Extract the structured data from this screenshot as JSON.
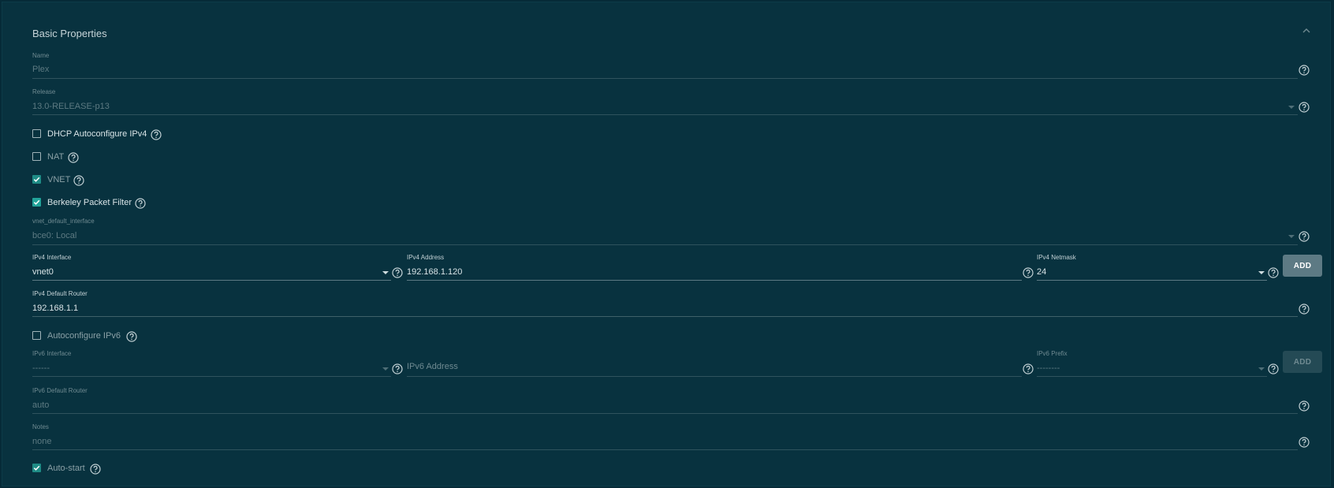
{
  "section": {
    "title": "Basic Properties"
  },
  "name": {
    "label": "Name",
    "value": "Plex"
  },
  "release": {
    "label": "Release",
    "value": "13.0-RELEASE-p13"
  },
  "dhcp": {
    "label": "DHCP Autoconfigure IPv4",
    "checked": false
  },
  "nat": {
    "label": "NAT",
    "checked": false
  },
  "vnet": {
    "label": "VNET",
    "checked": true
  },
  "bpf": {
    "label": "Berkeley Packet Filter",
    "checked": true
  },
  "vnet_default_interface": {
    "label": "vnet_default_interface",
    "value": "bce0: Local"
  },
  "ipv4": {
    "interface_label": "IPv4 Interface",
    "interface_value": "vnet0",
    "address_label": "IPv4 Address",
    "address_value": "192.168.1.120",
    "netmask_label": "IPv4 Netmask",
    "netmask_value": "24",
    "add_label": "ADD",
    "router_label": "IPv4 Default Router",
    "router_value": "192.168.1.1"
  },
  "autoconfigure_ipv6": {
    "label": "Autoconfigure IPv6",
    "checked": false
  },
  "ipv6": {
    "interface_label": "IPv6 Interface",
    "interface_value": "------",
    "address_placeholder": "IPv6 Address",
    "prefix_label": "IPv6 Prefix",
    "prefix_value": "--------",
    "add_label": "ADD",
    "router_label": "IPv6 Default Router",
    "router_value": "auto"
  },
  "notes": {
    "label": "Notes",
    "value": "none"
  },
  "autostart": {
    "label": "Auto-start",
    "checked": true
  },
  "colors": {
    "background": "#08323f",
    "accent": "#22a39a",
    "button": "#5d7a84"
  },
  "icons": {
    "help": "help-circle-icon",
    "dropdown": "caret-down-icon",
    "collapse": "chevron-up-icon",
    "check": "check-icon"
  }
}
